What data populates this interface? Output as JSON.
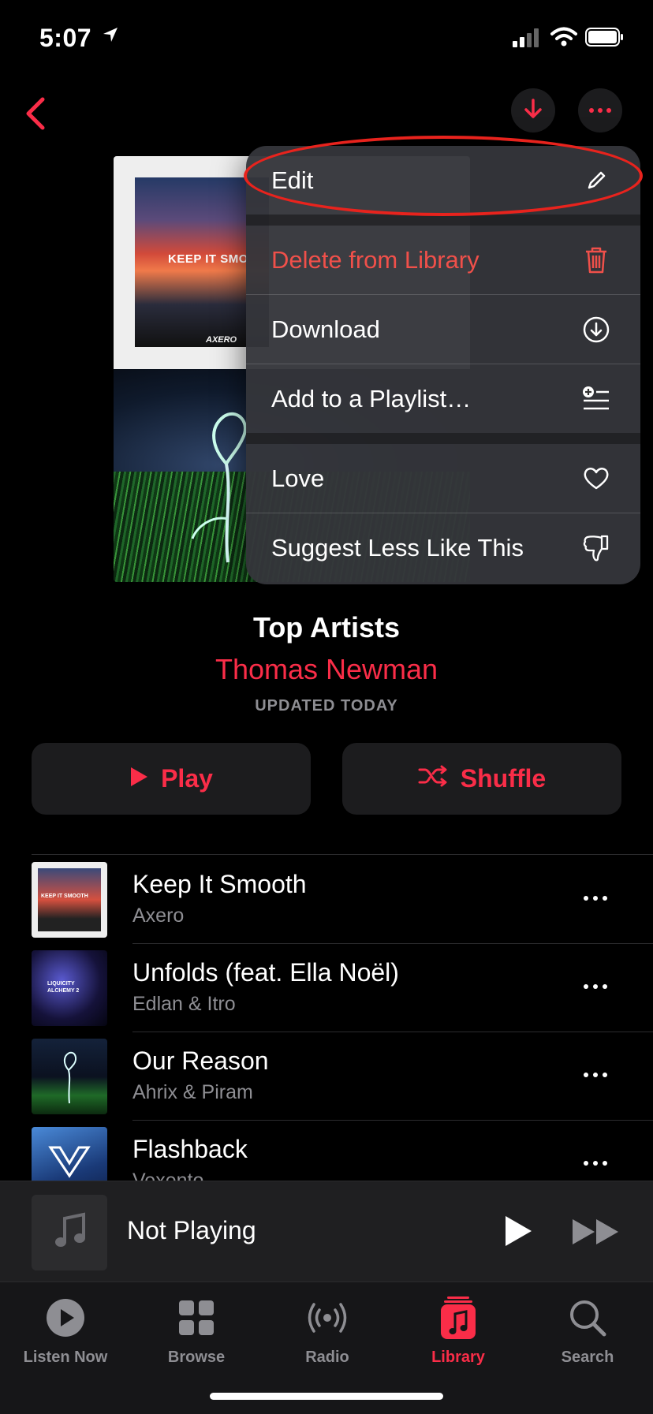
{
  "status_bar": {
    "time": "5:07"
  },
  "nav": {
    "back_icon": "chevron-left-icon",
    "download_icon": "download-arrow-icon",
    "more_icon": "ellipsis-icon"
  },
  "artwork": {
    "cover_text": "KEEP IT SMO",
    "cover_brand": "AXERO"
  },
  "menu": {
    "items": [
      {
        "label": "Edit",
        "icon": "pencil-icon"
      },
      {
        "label": "Delete from Library",
        "icon": "trash-icon",
        "color": "#f0504a"
      },
      {
        "label": "Download",
        "icon": "download-circle-icon"
      },
      {
        "label": "Add to a Playlist…",
        "icon": "add-to-list-icon"
      },
      {
        "label": "Love",
        "icon": "heart-icon"
      },
      {
        "label": "Suggest Less Like This",
        "icon": "thumbs-down-icon"
      }
    ]
  },
  "playlist": {
    "title": "Top Artists",
    "curator": "Thomas Newman",
    "updated": "UPDATED TODAY",
    "play_label": "Play",
    "shuffle_label": "Shuffle"
  },
  "tracks": [
    {
      "title": "Keep It Smooth",
      "artist": "Axero",
      "thumb_text": "KEEP IT SMOOTH"
    },
    {
      "title": "Unfolds (feat. Ella Noël)",
      "artist": "Edlan & Itro",
      "thumb_text": "LIQUICITY ALCHEMY 2"
    },
    {
      "title": "Our Reason",
      "artist": "Ahrix & Piram"
    },
    {
      "title": "Flashback",
      "artist": "Vexento"
    }
  ],
  "mini_player": {
    "title": "Not Playing"
  },
  "tabs": [
    {
      "label": "Listen Now",
      "icon": "play-circle-icon"
    },
    {
      "label": "Browse",
      "icon": "grid-icon"
    },
    {
      "label": "Radio",
      "icon": "broadcast-icon"
    },
    {
      "label": "Library",
      "icon": "music-note-square-icon",
      "active": true
    },
    {
      "label": "Search",
      "icon": "magnifier-icon"
    }
  ],
  "colors": {
    "accent": "#fa2d48",
    "destructive": "#f0504a",
    "annotation": "#e8231d"
  }
}
